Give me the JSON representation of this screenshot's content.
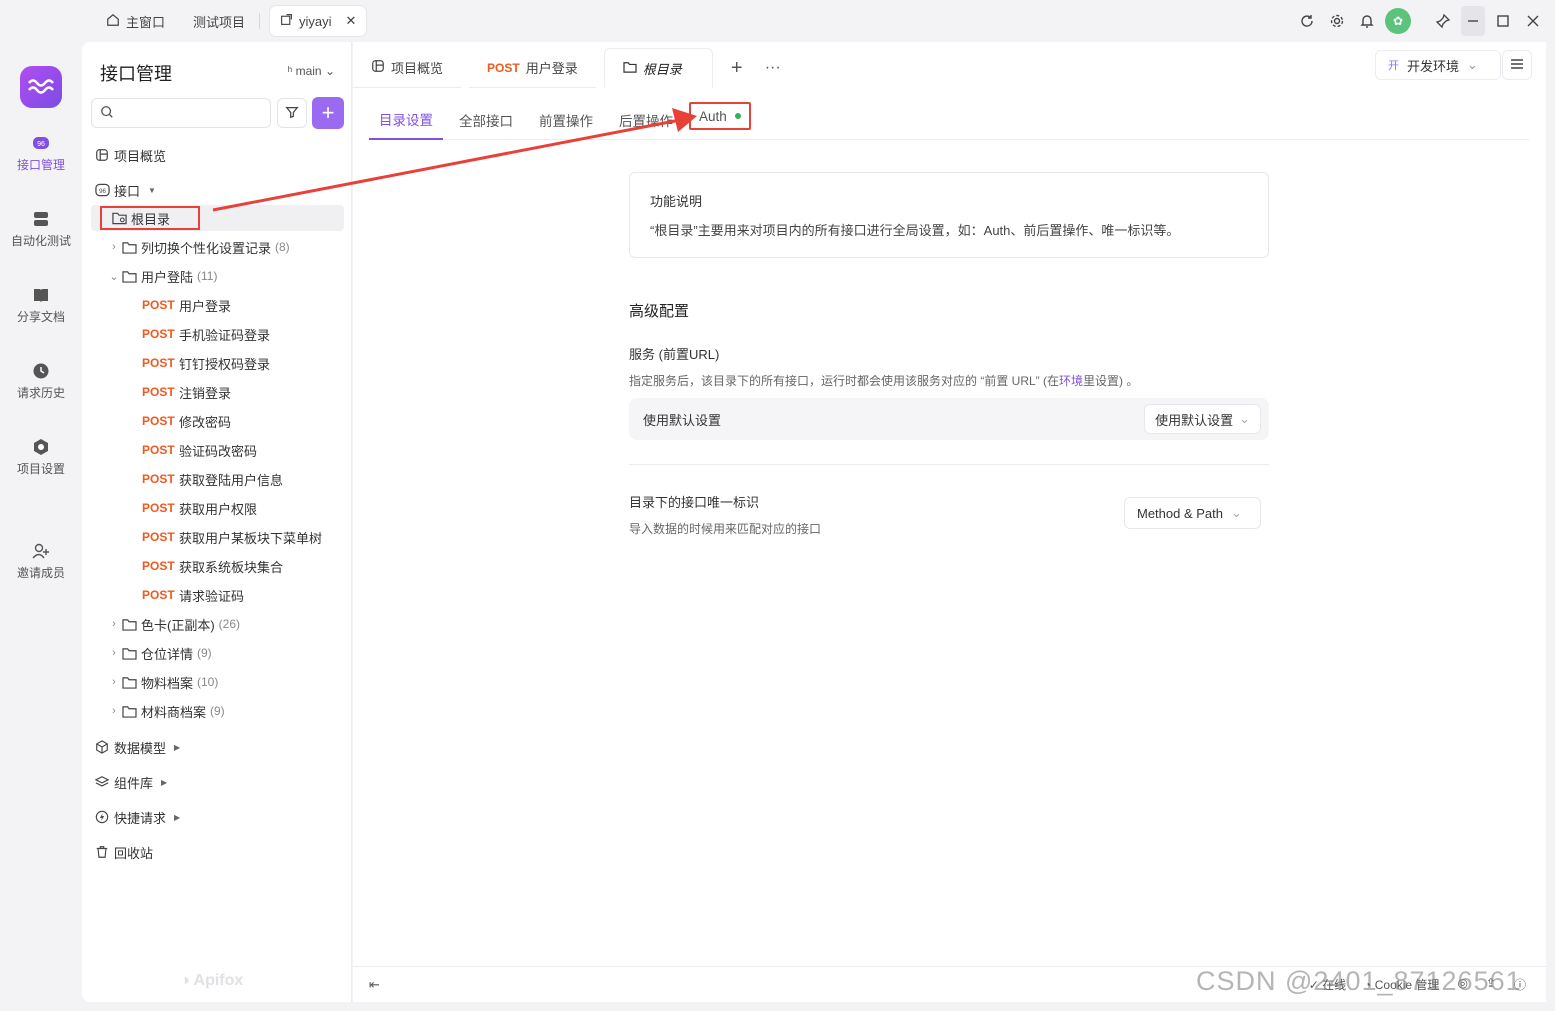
{
  "titlebar": {
    "tabs": [
      {
        "label": "主窗口"
      },
      {
        "label": "测试项目"
      },
      {
        "label": "yiyayi"
      }
    ]
  },
  "rail": {
    "items": [
      {
        "label": "接口管理",
        "icon": "api-icon"
      },
      {
        "label": "自动化测试",
        "icon": "automation-icon"
      },
      {
        "label": "分享文档",
        "icon": "book-icon"
      },
      {
        "label": "请求历史",
        "icon": "history-icon"
      },
      {
        "label": "项目设置",
        "icon": "settings-icon"
      },
      {
        "label": "邀请成员",
        "icon": "invite-user-icon"
      }
    ]
  },
  "sidebar": {
    "title": "接口管理",
    "branch": "main",
    "tree": {
      "overview": "项目概览",
      "apis": "接口",
      "root": "根目录",
      "folders": [
        {
          "name": "列切换个性化设置记录",
          "count": "(8)"
        },
        {
          "name": "用户登陆",
          "count": "(11)"
        }
      ],
      "endpoints": [
        {
          "method": "POST",
          "name": "用户登录"
        },
        {
          "method": "POST",
          "name": "手机验证码登录"
        },
        {
          "method": "POST",
          "name": "钉钉授权码登录"
        },
        {
          "method": "POST",
          "name": "注销登录"
        },
        {
          "method": "POST",
          "name": "修改密码"
        },
        {
          "method": "POST",
          "name": "验证码改密码"
        },
        {
          "method": "POST",
          "name": "获取登陆用户信息"
        },
        {
          "method": "POST",
          "name": "获取用户权限"
        },
        {
          "method": "POST",
          "name": "获取用户某板块下菜单树"
        },
        {
          "method": "POST",
          "name": "获取系统板块集合"
        },
        {
          "method": "POST",
          "name": "请求验证码"
        }
      ],
      "more_folders": [
        {
          "name": "色卡(正副本)",
          "count": "(26)"
        },
        {
          "name": "仓位详情",
          "count": "(9)"
        },
        {
          "name": "物料档案",
          "count": "(10)"
        },
        {
          "name": "材料商档案",
          "count": "(9)"
        }
      ],
      "data_model": "数据模型",
      "components": "组件库",
      "quick_request": "快捷请求",
      "trash": "回收站"
    },
    "watermark": "Apifox"
  },
  "main": {
    "doc_tabs": [
      {
        "label": "项目概览"
      },
      {
        "method": "POST",
        "label": "用户登录"
      },
      {
        "label": "根目录"
      }
    ],
    "env": {
      "badge": "开",
      "label": "开发环境"
    },
    "sub_tabs": [
      {
        "label": "目录设置"
      },
      {
        "label": "全部接口"
      },
      {
        "label": "前置操作"
      },
      {
        "label": "后置操作"
      },
      {
        "label": "Auth"
      }
    ],
    "info": {
      "title": "功能说明",
      "desc": "“根目录”主要用来对项目内的所有接口进行全局设置，如：Auth、前后置操作、唯一标识等。"
    },
    "advanced": {
      "title": "高级配置",
      "service_label": "服务 (前置URL)",
      "service_hint_pre": "指定服务后，该目录下的所有接口，运行时都会使用该服务对应的 “前置 URL” (在",
      "service_hint_link": "环境",
      "service_hint_post": "里设置) 。",
      "service_row_label": "使用默认设置",
      "service_select": "使用默认设置",
      "uid_label": "目录下的接口唯一标识",
      "uid_hint": "导入数据的时候用来匹配对应的接口",
      "uid_select": "Method & Path"
    },
    "footer": {
      "online": "在线",
      "cookie": "Cookie 管理"
    }
  },
  "overlay": {
    "watermark": "CSDN @2401_87126561"
  },
  "colors": {
    "accent": "#8250df",
    "method_post": "#ef5a1f",
    "annotation_red": "#e8413a",
    "status_green": "#2fb35b"
  }
}
